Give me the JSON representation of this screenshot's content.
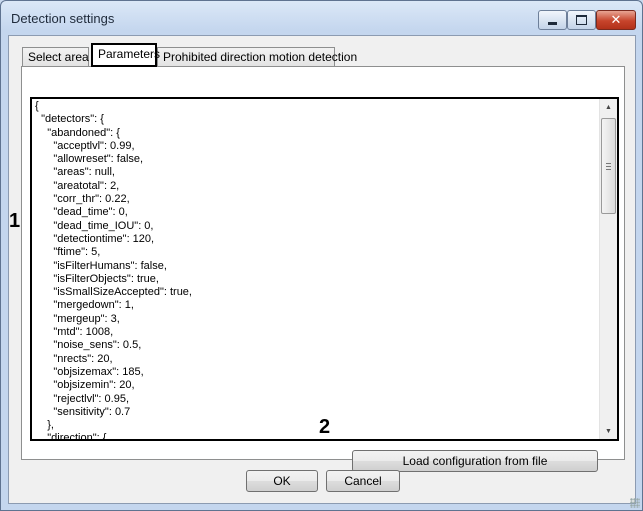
{
  "window": {
    "title": "Detection settings"
  },
  "tabs": [
    {
      "label": "Select area"
    },
    {
      "label": "Parameters"
    },
    {
      "label": "Prohibited direction motion detection"
    }
  ],
  "editor": {
    "text": "{\n  \"detectors\": {\n    \"abandoned\": {\n      \"acceptlvl\": 0.99,\n      \"allowreset\": false,\n      \"areas\": null,\n      \"areatotal\": 2,\n      \"corr_thr\": 0.22,\n      \"dead_time\": 0,\n      \"dead_time_IOU\": 0,\n      \"detectiontime\": 120,\n      \"ftime\": 5,\n      \"isFilterHumans\": false,\n      \"isFilterObjects\": true,\n      \"isSmallSizeAccepted\": true,\n      \"mergedown\": 1,\n      \"mergeup\": 3,\n      \"mtd\": 1008,\n      \"noise_sens\": 0.5,\n      \"nrects\": 20,\n      \"objsizemax\": 185,\n      \"objsizemin\": 20,\n      \"rejectlvl\": 0.95,\n      \"sensitivity\": 0.7\n    },\n    \"direction\": {"
  },
  "callouts": {
    "editor": "1",
    "load_button": "2"
  },
  "buttons": {
    "load_config": "Load configuration from file",
    "ok": "OK",
    "cancel": "Cancel"
  },
  "icons": {
    "minimize": "minimize-icon",
    "maximize": "maximize-icon",
    "close": "close-icon"
  },
  "colors": {
    "close_button": "#c7442b",
    "window_frame": "#c4d6ee",
    "highlight_border": "#000000"
  }
}
